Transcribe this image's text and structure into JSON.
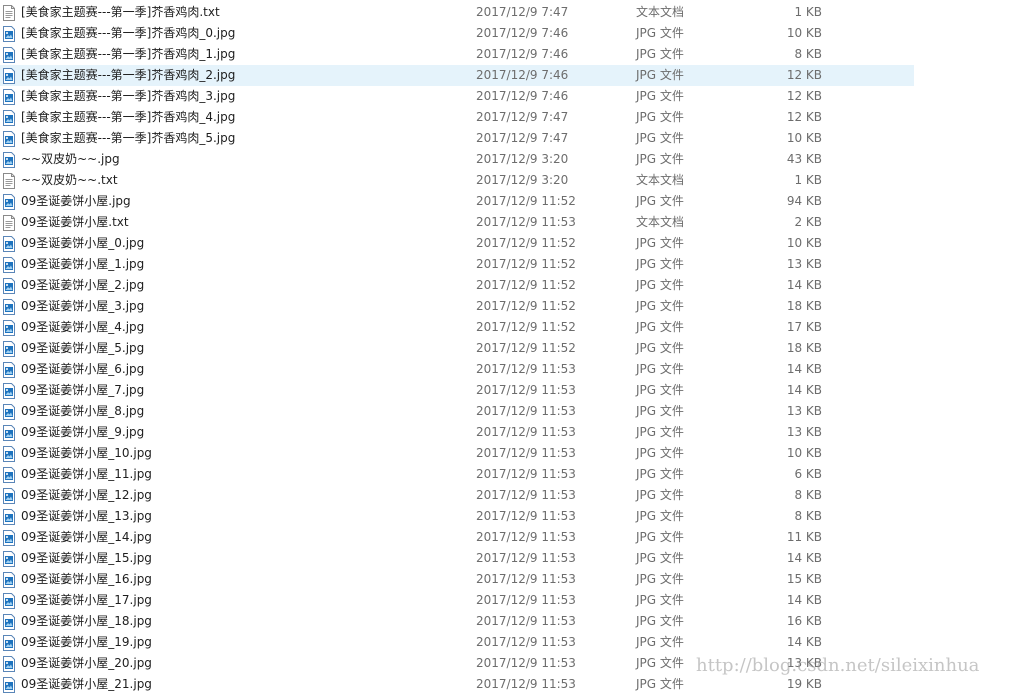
{
  "colors": {
    "selection": "#e5f3fb",
    "name_text": "#1e1e1e",
    "meta_text": "#6d6d6d",
    "jpg_icon": "#1e73be"
  },
  "selected_index": 3,
  "files": [
    {
      "name": "[美食家主题赛---第一季]芥香鸡肉.txt",
      "date": "2017/12/9 7:47",
      "type": "文本文档",
      "size": "1 KB",
      "icon": "text-file-icon"
    },
    {
      "name": "[美食家主题赛---第一季]芥香鸡肉_0.jpg",
      "date": "2017/12/9 7:46",
      "type": "JPG 文件",
      "size": "10 KB",
      "icon": "image-file-icon"
    },
    {
      "name": "[美食家主题赛---第一季]芥香鸡肉_1.jpg",
      "date": "2017/12/9 7:46",
      "type": "JPG 文件",
      "size": "8 KB",
      "icon": "image-file-icon"
    },
    {
      "name": "[美食家主题赛---第一季]芥香鸡肉_2.jpg",
      "date": "2017/12/9 7:46",
      "type": "JPG 文件",
      "size": "12 KB",
      "icon": "image-file-icon"
    },
    {
      "name": "[美食家主题赛---第一季]芥香鸡肉_3.jpg",
      "date": "2017/12/9 7:46",
      "type": "JPG 文件",
      "size": "12 KB",
      "icon": "image-file-icon"
    },
    {
      "name": "[美食家主题赛---第一季]芥香鸡肉_4.jpg",
      "date": "2017/12/9 7:47",
      "type": "JPG 文件",
      "size": "12 KB",
      "icon": "image-file-icon"
    },
    {
      "name": "[美食家主题赛---第一季]芥香鸡肉_5.jpg",
      "date": "2017/12/9 7:47",
      "type": "JPG 文件",
      "size": "10 KB",
      "icon": "image-file-icon"
    },
    {
      "name": "~~双皮奶~~.jpg",
      "date": "2017/12/9 3:20",
      "type": "JPG 文件",
      "size": "43 KB",
      "icon": "image-file-icon"
    },
    {
      "name": "~~双皮奶~~.txt",
      "date": "2017/12/9 3:20",
      "type": "文本文档",
      "size": "1 KB",
      "icon": "text-file-icon"
    },
    {
      "name": "09圣诞姜饼小屋.jpg",
      "date": "2017/12/9 11:52",
      "type": "JPG 文件",
      "size": "94 KB",
      "icon": "image-file-icon"
    },
    {
      "name": "09圣诞姜饼小屋.txt",
      "date": "2017/12/9 11:53",
      "type": "文本文档",
      "size": "2 KB",
      "icon": "text-file-icon"
    },
    {
      "name": "09圣诞姜饼小屋_0.jpg",
      "date": "2017/12/9 11:52",
      "type": "JPG 文件",
      "size": "10 KB",
      "icon": "image-file-icon"
    },
    {
      "name": "09圣诞姜饼小屋_1.jpg",
      "date": "2017/12/9 11:52",
      "type": "JPG 文件",
      "size": "13 KB",
      "icon": "image-file-icon"
    },
    {
      "name": "09圣诞姜饼小屋_2.jpg",
      "date": "2017/12/9 11:52",
      "type": "JPG 文件",
      "size": "14 KB",
      "icon": "image-file-icon"
    },
    {
      "name": "09圣诞姜饼小屋_3.jpg",
      "date": "2017/12/9 11:52",
      "type": "JPG 文件",
      "size": "18 KB",
      "icon": "image-file-icon"
    },
    {
      "name": "09圣诞姜饼小屋_4.jpg",
      "date": "2017/12/9 11:52",
      "type": "JPG 文件",
      "size": "17 KB",
      "icon": "image-file-icon"
    },
    {
      "name": "09圣诞姜饼小屋_5.jpg",
      "date": "2017/12/9 11:52",
      "type": "JPG 文件",
      "size": "18 KB",
      "icon": "image-file-icon"
    },
    {
      "name": "09圣诞姜饼小屋_6.jpg",
      "date": "2017/12/9 11:53",
      "type": "JPG 文件",
      "size": "14 KB",
      "icon": "image-file-icon"
    },
    {
      "name": "09圣诞姜饼小屋_7.jpg",
      "date": "2017/12/9 11:53",
      "type": "JPG 文件",
      "size": "14 KB",
      "icon": "image-file-icon"
    },
    {
      "name": "09圣诞姜饼小屋_8.jpg",
      "date": "2017/12/9 11:53",
      "type": "JPG 文件",
      "size": "13 KB",
      "icon": "image-file-icon"
    },
    {
      "name": "09圣诞姜饼小屋_9.jpg",
      "date": "2017/12/9 11:53",
      "type": "JPG 文件",
      "size": "13 KB",
      "icon": "image-file-icon"
    },
    {
      "name": "09圣诞姜饼小屋_10.jpg",
      "date": "2017/12/9 11:53",
      "type": "JPG 文件",
      "size": "10 KB",
      "icon": "image-file-icon"
    },
    {
      "name": "09圣诞姜饼小屋_11.jpg",
      "date": "2017/12/9 11:53",
      "type": "JPG 文件",
      "size": "6 KB",
      "icon": "image-file-icon"
    },
    {
      "name": "09圣诞姜饼小屋_12.jpg",
      "date": "2017/12/9 11:53",
      "type": "JPG 文件",
      "size": "8 KB",
      "icon": "image-file-icon"
    },
    {
      "name": "09圣诞姜饼小屋_13.jpg",
      "date": "2017/12/9 11:53",
      "type": "JPG 文件",
      "size": "8 KB",
      "icon": "image-file-icon"
    },
    {
      "name": "09圣诞姜饼小屋_14.jpg",
      "date": "2017/12/9 11:53",
      "type": "JPG 文件",
      "size": "11 KB",
      "icon": "image-file-icon"
    },
    {
      "name": "09圣诞姜饼小屋_15.jpg",
      "date": "2017/12/9 11:53",
      "type": "JPG 文件",
      "size": "14 KB",
      "icon": "image-file-icon"
    },
    {
      "name": "09圣诞姜饼小屋_16.jpg",
      "date": "2017/12/9 11:53",
      "type": "JPG 文件",
      "size": "15 KB",
      "icon": "image-file-icon"
    },
    {
      "name": "09圣诞姜饼小屋_17.jpg",
      "date": "2017/12/9 11:53",
      "type": "JPG 文件",
      "size": "14 KB",
      "icon": "image-file-icon"
    },
    {
      "name": "09圣诞姜饼小屋_18.jpg",
      "date": "2017/12/9 11:53",
      "type": "JPG 文件",
      "size": "16 KB",
      "icon": "image-file-icon"
    },
    {
      "name": "09圣诞姜饼小屋_19.jpg",
      "date": "2017/12/9 11:53",
      "type": "JPG 文件",
      "size": "14 KB",
      "icon": "image-file-icon"
    },
    {
      "name": "09圣诞姜饼小屋_20.jpg",
      "date": "2017/12/9 11:53",
      "type": "JPG 文件",
      "size": "13 KB",
      "icon": "image-file-icon"
    },
    {
      "name": "09圣诞姜饼小屋_21.jpg",
      "date": "2017/12/9 11:53",
      "type": "JPG 文件",
      "size": "19 KB",
      "icon": "image-file-icon"
    }
  ],
  "watermark": "http://blog.csdn.net/sileixinhua"
}
